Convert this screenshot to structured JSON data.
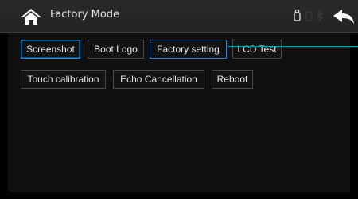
{
  "header": {
    "title": "Factory Mode",
    "home_icon": "home-icon",
    "back_icon": "back-arrow-icon",
    "status_icons": [
      "usb-icon",
      "sd-card-icon",
      "bluetooth-icon"
    ]
  },
  "buttons": {
    "screenshot": "Screenshot",
    "boot_logo": "Boot Logo",
    "factory_setting": "Factory setting",
    "lcd_test": "LCD Test",
    "touch_calibration": "Touch calibration",
    "echo_cancellation": "Echo Cancellation",
    "reboot": "Reboot"
  },
  "colors": {
    "accent": "#2f8fd8",
    "background": "#101010",
    "header": "#262626",
    "text": "#e8e8e8"
  }
}
